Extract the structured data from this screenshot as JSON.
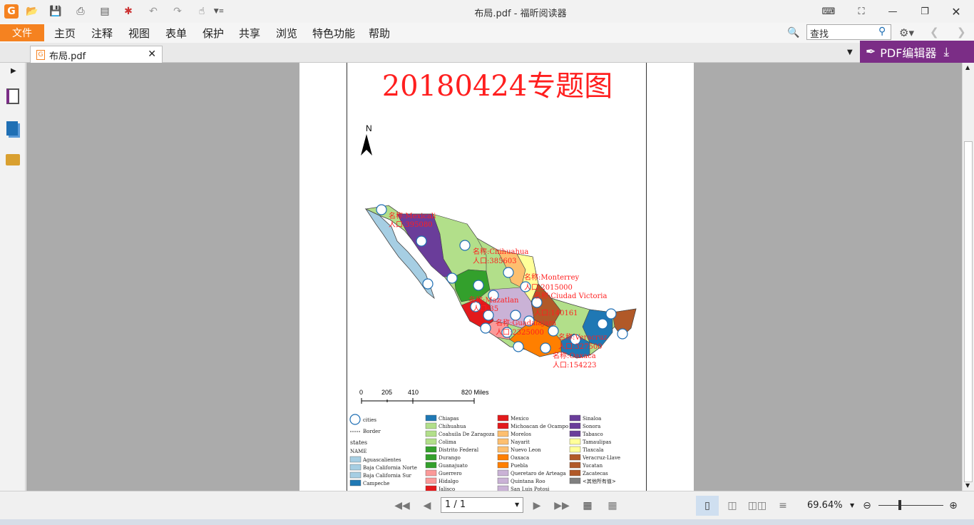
{
  "window": {
    "title": "布局.pdf - 福昕阅读器"
  },
  "menu": {
    "file": "文件",
    "items": [
      "主页",
      "注释",
      "视图",
      "表单",
      "保护",
      "共享",
      "浏览",
      "特色功能",
      "帮助"
    ]
  },
  "search": {
    "placeholder": "查找"
  },
  "tab": {
    "label": "布局.pdf"
  },
  "pdf_editor": {
    "label": "PDF编辑器"
  },
  "map": {
    "title": "20180424专题图",
    "north": "N",
    "scale": {
      "ticks": [
        "0",
        "205",
        "410",
        "820 Miles"
      ]
    },
    "labels": [
      {
        "name": "名称:Mexicali",
        "pop": "人口:395080"
      },
      {
        "name": "名称:Chihuahua",
        "pop": "人口:385603"
      },
      {
        "name": "名称:Monterrey",
        "pop": "人口:2015000"
      },
      {
        "name": "名称:Ciudad Victoria",
        "pop": "人口:140161"
      },
      {
        "name": "名称:Mazatlan",
        "pop": "人口:35"
      },
      {
        "name": "名称:Guadalajara",
        "pop": "人口:2325000"
      },
      {
        "name": "名称:Veracruz",
        "pop": "人口:327500"
      },
      {
        "name": "名称:Oaxaca",
        "pop": "人口:154223"
      }
    ],
    "legend": {
      "cities": "cities",
      "border": "Border",
      "states_title": "states",
      "field": "NAME",
      "col1": [
        {
          "n": "Aguascalientes",
          "c": "#a6cee3"
        },
        {
          "n": "Baja California Norte",
          "c": "#a6cee3"
        },
        {
          "n": "Baja California Sur",
          "c": "#a6cee3"
        },
        {
          "n": "Campeche",
          "c": "#1f78b4"
        }
      ],
      "col2": [
        {
          "n": "Chiapas",
          "c": "#1f78b4"
        },
        {
          "n": "Chihuahua",
          "c": "#b2df8a"
        },
        {
          "n": "Coahuila De Zaragoza",
          "c": "#b2df8a"
        },
        {
          "n": "Colima",
          "c": "#b2df8a"
        },
        {
          "n": "Distrito Federal",
          "c": "#33a02c"
        },
        {
          "n": "Durango",
          "c": "#33a02c"
        },
        {
          "n": "Guanajuato",
          "c": "#33a02c"
        },
        {
          "n": "Guerrero",
          "c": "#fb9a99"
        },
        {
          "n": "Hidalgo",
          "c": "#fb9a99"
        },
        {
          "n": "Jalisco",
          "c": "#e31a1c"
        }
      ],
      "col3": [
        {
          "n": "Mexico",
          "c": "#e31a1c"
        },
        {
          "n": "Michoacan de Ocampo",
          "c": "#e31a1c"
        },
        {
          "n": "Morelos",
          "c": "#fdbf6f"
        },
        {
          "n": "Nayarit",
          "c": "#fdbf6f"
        },
        {
          "n": "Nuevo Leon",
          "c": "#fdbf6f"
        },
        {
          "n": "Oaxaca",
          "c": "#ff7f00"
        },
        {
          "n": "Puebla",
          "c": "#ff7f00"
        },
        {
          "n": "Queretaro de Arteaga",
          "c": "#cab2d6"
        },
        {
          "n": "Quintana Roo",
          "c": "#cab2d6"
        },
        {
          "n": "San Luis Potosi",
          "c": "#cab2d6"
        }
      ],
      "col4": [
        {
          "n": "Sinaloa",
          "c": "#6a3d9a"
        },
        {
          "n": "Sonora",
          "c": "#6a3d9a"
        },
        {
          "n": "Tabasco",
          "c": "#6a3d9a"
        },
        {
          "n": "Tamaulipas",
          "c": "#ffff99"
        },
        {
          "n": "Tlaxcala",
          "c": "#ffff99"
        },
        {
          "n": "Veracruz-Llave",
          "c": "#b15928"
        },
        {
          "n": "Yucatan",
          "c": "#b15928"
        },
        {
          "n": "Zacatecas",
          "c": "#b15928"
        },
        {
          "n": "<其他所有值>",
          "c": "#808080"
        }
      ]
    }
  },
  "status": {
    "page": "1 / 1",
    "zoom": "69.64%"
  },
  "colors": {
    "accent": "#f58220",
    "editor": "#7b2d86",
    "label_red": "#ff1f1f"
  }
}
